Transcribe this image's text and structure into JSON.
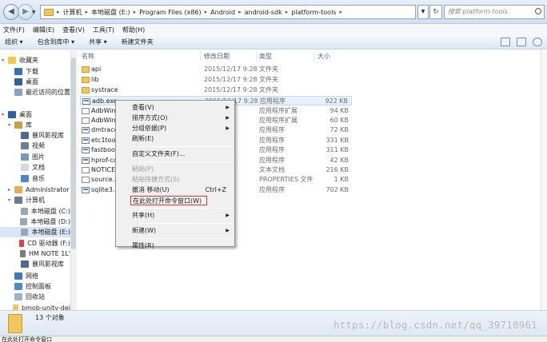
{
  "address": {
    "crumbs": [
      "计算机",
      "本地磁盘 (E:)",
      "Program Files (x86)",
      "Android",
      "android-sdk",
      "platform-tools"
    ],
    "search_placeholder": "搜索 platform-tools"
  },
  "menubar": [
    "文件(F)",
    "编辑(E)",
    "查看(V)",
    "工具(T)",
    "帮助(H)"
  ],
  "toolbar": {
    "organize": "组织 ▾",
    "include": "包含到库中 ▾",
    "share": "共享 ▾",
    "new_folder": "新建文件夹"
  },
  "nav": [
    {
      "label": "收藏夹",
      "level": 0,
      "icon": "#f2c94c",
      "tri": "▾"
    },
    {
      "label": "下载",
      "level": 1,
      "icon": "#3a6fb0"
    },
    {
      "label": "桌面",
      "level": 1,
      "icon": "#2f5f9e"
    },
    {
      "label": "最近访问的位置",
      "level": 1,
      "icon": "#8aa3c1"
    },
    {
      "label": "",
      "level": 0,
      "icon": ""
    },
    {
      "label": "桌面",
      "level": 0,
      "icon": "#2f5f9e",
      "tri": "▾"
    },
    {
      "label": "库",
      "level": 1,
      "icon": "#c9a04a",
      "tri": "▾"
    },
    {
      "label": "暴风影视库",
      "level": 2,
      "icon": "#4a6b8c"
    },
    {
      "label": "视频",
      "level": 2,
      "icon": "#6b7f95"
    },
    {
      "label": "图片",
      "level": 2,
      "icon": "#7a98b8"
    },
    {
      "label": "文档",
      "level": 2,
      "icon": "#d9d9d9"
    },
    {
      "label": "音乐",
      "level": 2,
      "icon": "#4f86c6"
    },
    {
      "label": "Administrator",
      "level": 1,
      "icon": "#e3b05a",
      "tri": "▸"
    },
    {
      "label": "计算机",
      "level": 1,
      "icon": "#6c7c8e",
      "tri": "▾"
    },
    {
      "label": "本地磁盘 (C:)",
      "level": 2,
      "icon": "#9aa6b3"
    },
    {
      "label": "本地磁盘 (D:)",
      "level": 2,
      "icon": "#9aa6b3"
    },
    {
      "label": "本地磁盘 (E:)",
      "level": 2,
      "icon": "#9aa6b3",
      "selected": true
    },
    {
      "label": "CD 驱动器 (F:)",
      "level": 2,
      "icon": "#d64545"
    },
    {
      "label": "HM NOTE 1L'",
      "level": 2,
      "icon": "#7b7b7b"
    },
    {
      "label": "暴风影视库",
      "level": 2,
      "icon": "#4a6b8c"
    },
    {
      "label": "网络",
      "level": 1,
      "icon": "#3d78b8"
    },
    {
      "label": "控制面板",
      "level": 1,
      "icon": "#4a8bc2"
    },
    {
      "label": "回收站",
      "level": 1,
      "icon": "#9bb3c9"
    },
    {
      "label": "bmob-unity-dei",
      "level": 1,
      "icon": "#f0c75e"
    }
  ],
  "columns": [
    "名称",
    "修改日期",
    "类型",
    "大小"
  ],
  "files": [
    {
      "name": "api",
      "date": "2015/12/17 9:28",
      "type": "文件夹",
      "size": "",
      "kind": "folder"
    },
    {
      "name": "lib",
      "date": "2015/12/17 9:28",
      "type": "文件夹",
      "size": "",
      "kind": "folder"
    },
    {
      "name": "systrace",
      "date": "2015/12/17 9:28",
      "type": "文件夹",
      "size": "",
      "kind": "folder"
    },
    {
      "name": "adb.exe",
      "date": "2015/12/17 9:28",
      "type": "应用程序",
      "size": "922 KB",
      "kind": "exe"
    },
    {
      "name": "AdbWinA",
      "date": "",
      "type": "应用程序扩展",
      "size": "94 KB",
      "kind": "dll"
    },
    {
      "name": "AdbWinU",
      "date": "",
      "type": "应用程序扩展",
      "size": "60 KB",
      "kind": "dll"
    },
    {
      "name": "dmtracec",
      "date": "",
      "type": "应用程序",
      "size": "72 KB",
      "kind": "exe"
    },
    {
      "name": "etc1tool.",
      "date": "",
      "type": "应用程序",
      "size": "331 KB",
      "kind": "exe"
    },
    {
      "name": "fastboot.",
      "date": "",
      "type": "应用程序",
      "size": "311 KB",
      "kind": "exe"
    },
    {
      "name": "hprof-co",
      "date": "",
      "type": "应用程序",
      "size": "42 KB",
      "kind": "exe"
    },
    {
      "name": "NOTICE.t",
      "date": "",
      "type": "文本文档",
      "size": "216 KB",
      "kind": "txt"
    },
    {
      "name": "source.p",
      "date": "",
      "type": "PROPERTIES 文件",
      "size": "1 KB",
      "kind": "txt"
    },
    {
      "name": "sqlite3.e",
      "date": "",
      "type": "应用程序",
      "size": "702 KB",
      "kind": "exe"
    }
  ],
  "context_menu": [
    {
      "label": "查看(V)",
      "arrow": true
    },
    {
      "label": "排序方式(O)",
      "arrow": true
    },
    {
      "label": "分组依据(P)",
      "arrow": true
    },
    {
      "label": "刷新(E)"
    },
    {
      "sep": true
    },
    {
      "label": "自定义文件夹(F)..."
    },
    {
      "sep": true
    },
    {
      "label": "粘贴(P)",
      "disabled": true
    },
    {
      "label": "粘贴快捷方式(S)",
      "disabled": true
    },
    {
      "label": "撤消 移动(U)",
      "shortcut": "Ctrl+Z"
    },
    {
      "label": "在此处打开命令窗口(W)",
      "highlight": true
    },
    {
      "sep": true
    },
    {
      "label": "共享(H)",
      "arrow": true
    },
    {
      "sep": true
    },
    {
      "label": "新建(W)",
      "arrow": true
    },
    {
      "sep": true
    },
    {
      "label": "属性(R)"
    }
  ],
  "details": {
    "count": "13 个对象",
    "watermark": "https://blog.csdn.net/qq_39710961"
  },
  "status": "在此处打开命令窗口"
}
